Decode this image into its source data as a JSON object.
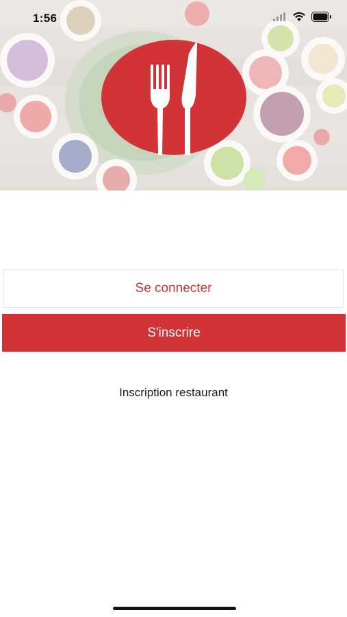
{
  "status_bar": {
    "time": "1:56",
    "icons": [
      "signal-icon",
      "wifi-icon",
      "battery-icon"
    ]
  },
  "hero": {
    "logo_icon": "fork-knife-logo-icon"
  },
  "actions": {
    "login_label": "Se connecter",
    "signup_label": "S'inscrire",
    "restaurant_signup_label": "Inscription restaurant"
  },
  "colors": {
    "brand_red": "#d13336",
    "background": "#ffffff"
  }
}
